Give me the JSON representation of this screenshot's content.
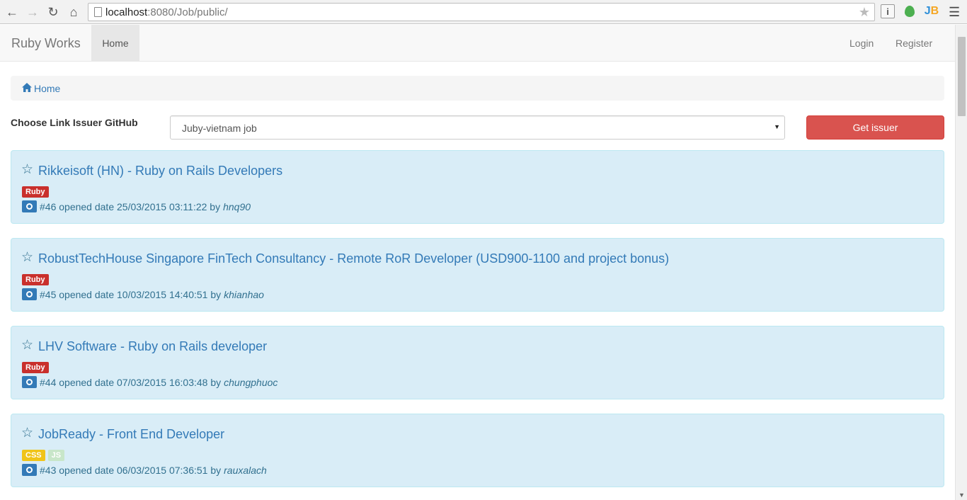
{
  "browser": {
    "url_host": "localhost",
    "url_rest": ":8080/Job/public/",
    "ext_info": "i",
    "ext_jb_left": "J",
    "ext_jb_right": "B",
    "back_icon": "arrow-left",
    "forward_icon": "arrow-right",
    "reload_icon": "reload",
    "home_icon": "home"
  },
  "navbar": {
    "brand": "Ruby Works",
    "home": "Home",
    "login": "Login",
    "register": "Register"
  },
  "breadcrumb": {
    "home": "Home"
  },
  "form": {
    "label": "Choose Link Issuer GitHub",
    "selected": "Juby-vietnam job",
    "button": "Get issuer"
  },
  "colors": {
    "ruby": "#c9302c",
    "css": "#f0c419",
    "js": "#c8e6c9",
    "panel_bg": "#d9edf7",
    "button": "#d9534f"
  },
  "issues": [
    {
      "title": "Rikkeisoft (HN) - Ruby on Rails Developers",
      "labels": [
        {
          "text": "Ruby",
          "color": "#c9302c"
        }
      ],
      "number_text": "#46 opened date 25/03/2015 03:11:22 by",
      "author": "hnq90"
    },
    {
      "title": "RobustTechHouse Singapore FinTech Consultancy - Remote RoR Developer (USD900-1100 and project bonus)",
      "labels": [
        {
          "text": "Ruby",
          "color": "#c9302c"
        }
      ],
      "number_text": "#45 opened date 10/03/2015 14:40:51 by",
      "author": "khianhao"
    },
    {
      "title": "LHV Software - Ruby on Rails developer",
      "labels": [
        {
          "text": "Ruby",
          "color": "#c9302c"
        }
      ],
      "number_text": "#44 opened date 07/03/2015 16:03:48 by",
      "author": "chungphuoc"
    },
    {
      "title": "JobReady - Front End Developer",
      "labels": [
        {
          "text": "CSS",
          "color": "#f0c419"
        },
        {
          "text": "JS",
          "color": "#c8e6c9"
        }
      ],
      "number_text": "#43 opened date 06/03/2015 07:36:51 by",
      "author": "rauxalach"
    }
  ]
}
